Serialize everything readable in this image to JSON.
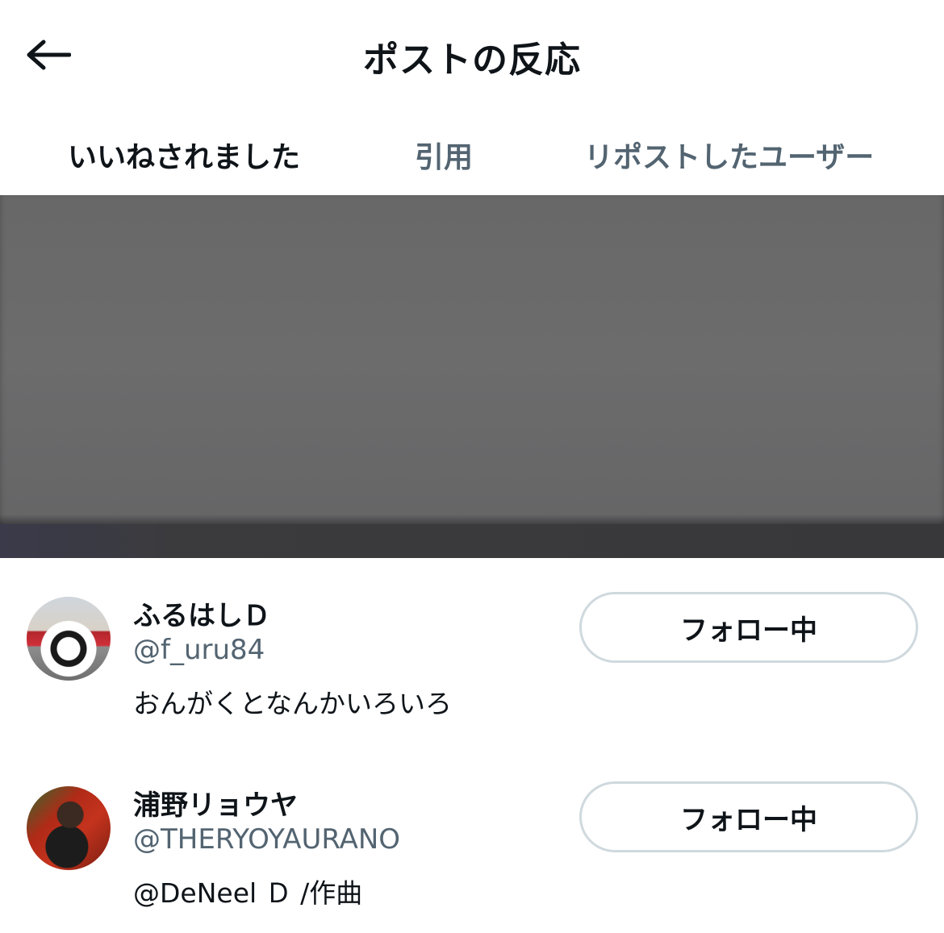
{
  "header": {
    "title": "ポストの反応",
    "back_icon": "arrow-left-icon"
  },
  "tabs": [
    {
      "label": "いいねされました",
      "active": true
    },
    {
      "label": "引用",
      "active": false
    },
    {
      "label": "リポストしたユーザー",
      "active": false
    }
  ],
  "users": [
    {
      "display_name": "ふるはしＤ",
      "handle": "@f_uru84",
      "bio": "おんがくとなんかいろいろ",
      "follow_label": "フォロー中"
    },
    {
      "display_name": "浦野リョウヤ",
      "handle": "@THERYOYAURANO",
      "bio": "@DeNeel Ｄ /作曲",
      "follow_label": "フォロー中"
    }
  ],
  "colors": {
    "text_primary": "#0f1419",
    "text_secondary": "#536471",
    "button_border": "#cfd9de",
    "redacted": "#6a6a6b"
  }
}
